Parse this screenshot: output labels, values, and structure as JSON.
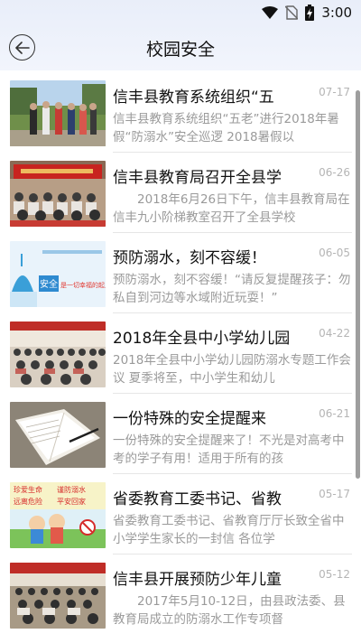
{
  "status": {
    "time": "3:00"
  },
  "header": {
    "title": "校园安全"
  },
  "articles": [
    {
      "title": "信丰县教育系统组织“五",
      "date": "07-17",
      "desc": "信丰县教育系统组织“五老”进行2018年暑假“防溺水”安全巡逻 2018暑假以"
    },
    {
      "title": "信丰县教育局召开全县学",
      "date": "06-26",
      "desc": "　　2018年6月26日下午，信丰县教育局在信丰九小阶梯教室召开了全县学校"
    },
    {
      "title": "预防溺水，刻不容缓！",
      "date": "06-05",
      "desc": "预防溺水，刻不容缓！“请反复提醒孩子：勿私自到河边等水域附近玩耍！”"
    },
    {
      "title": "2018年全县中小学幼儿园",
      "date": "04-22",
      "desc": "2018年全县中小学幼儿园防溺水专题工作会议 夏季将至，中小学生和幼儿"
    },
    {
      "title": "一份特殊的安全提醒来",
      "date": "06-21",
      "desc": "一份特殊的安全提醒来了！不光是对高考中考的学子有用！适用于所有的孩"
    },
    {
      "title": "省委教育工委书记、省教",
      "date": "05-17",
      "desc": "省委教育工委书记、省教育厅厅长致全省中小学学生家长的一封信 各位学"
    },
    {
      "title": "信丰县开展预防少年儿童",
      "date": "05-12",
      "desc": "　　2017年5月10-12日，由县政法委、县教育局成立的防溺水工作专项督"
    }
  ],
  "thumb_text": {
    "poster_line1": "珍爱生命",
    "poster_line2": "谨防溺水",
    "poster_line3": "远离危险",
    "poster_line4": "平安回家",
    "banner_word": "安全",
    "banner_slogan": "是一切幸福的起点"
  }
}
